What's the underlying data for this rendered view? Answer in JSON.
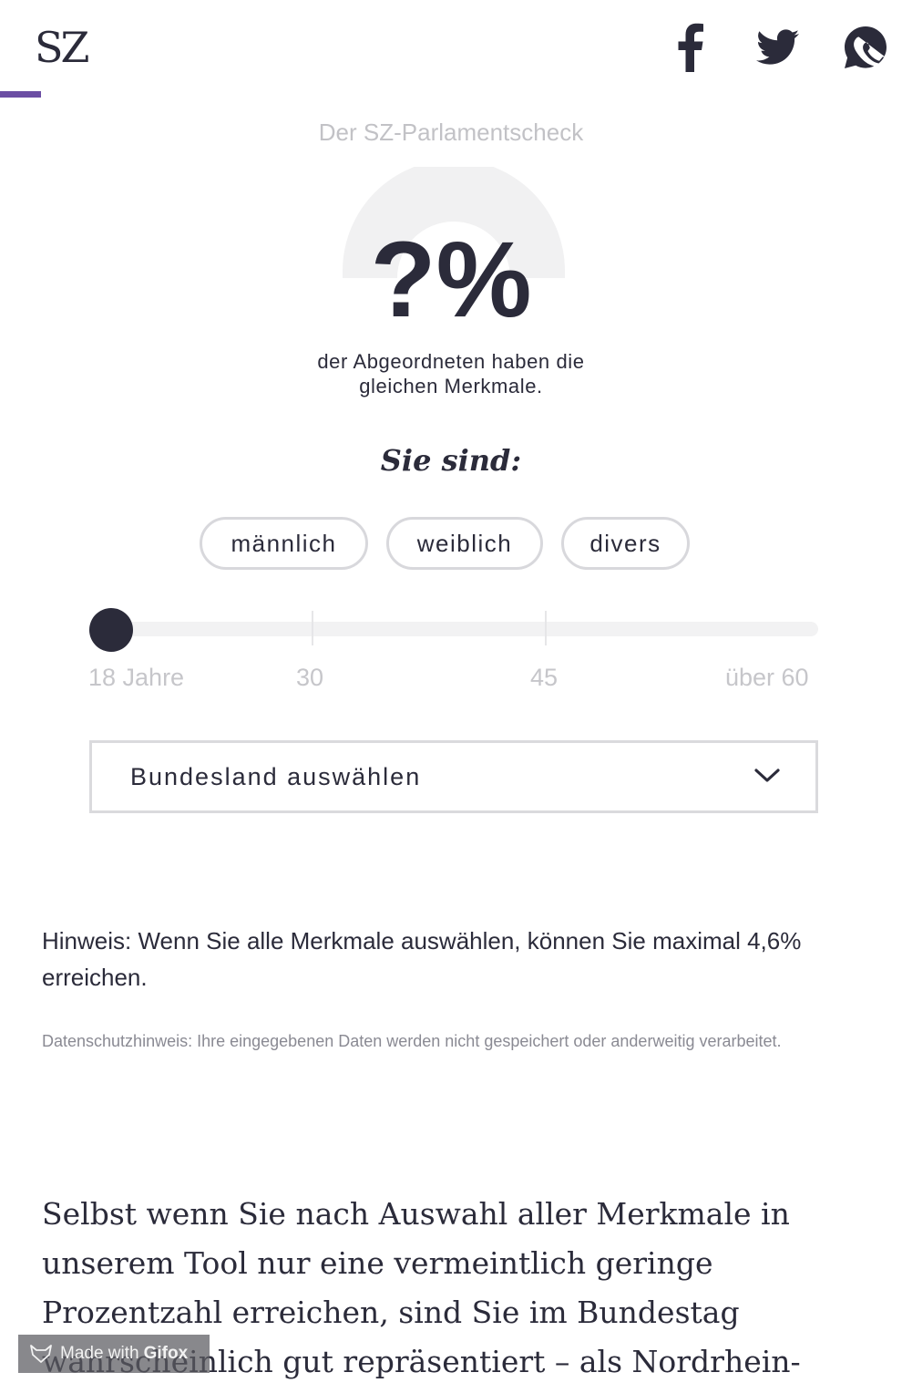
{
  "header": {
    "logo": "SZ",
    "accent_color": "#6b4ea3",
    "share_icons": [
      "facebook-icon",
      "twitter-icon",
      "whatsapp-icon"
    ]
  },
  "result": {
    "kicker": "Der SZ-Parlamentscheck",
    "value": "?%",
    "caption_line1": "der Abgeordneten haben die",
    "caption_line2": "gleichen Merkmale."
  },
  "profile": {
    "heading": "Sie sind:",
    "genders": [
      "männlich",
      "weiblich",
      "divers"
    ],
    "age_labels": [
      "18 Jahre",
      "30",
      "45",
      "über 60"
    ],
    "age_selected": "18 Jahre",
    "state_select_label": "Bundesland auswählen"
  },
  "notes": {
    "hint": "Hinweis: Wenn Sie alle Merkmale auswählen, können Sie maximal 4,6% erreichen.",
    "privacy": "Datenschutzhinweis: Ihre eingegebenen Daten werden nicht gespeichert oder anderweitig verarbeitet."
  },
  "article": {
    "line1": "Selbst wenn Sie nach Auswahl aller Merkmale in",
    "line2": "unserem Tool nur eine vermeintlich geringe",
    "line3": "Prozentzahl erreichen, sind Sie im Bundestag",
    "line4": "wahrscheinlich gut repräsentiert – als Nordrhein-"
  },
  "watermark": {
    "prefix": "Made with",
    "brand": "Gifox"
  },
  "colors": {
    "text": "#2b2b3a",
    "muted": "#c2c2c6",
    "pill_border": "#d8d8dc",
    "track": "#f2f2f3"
  }
}
